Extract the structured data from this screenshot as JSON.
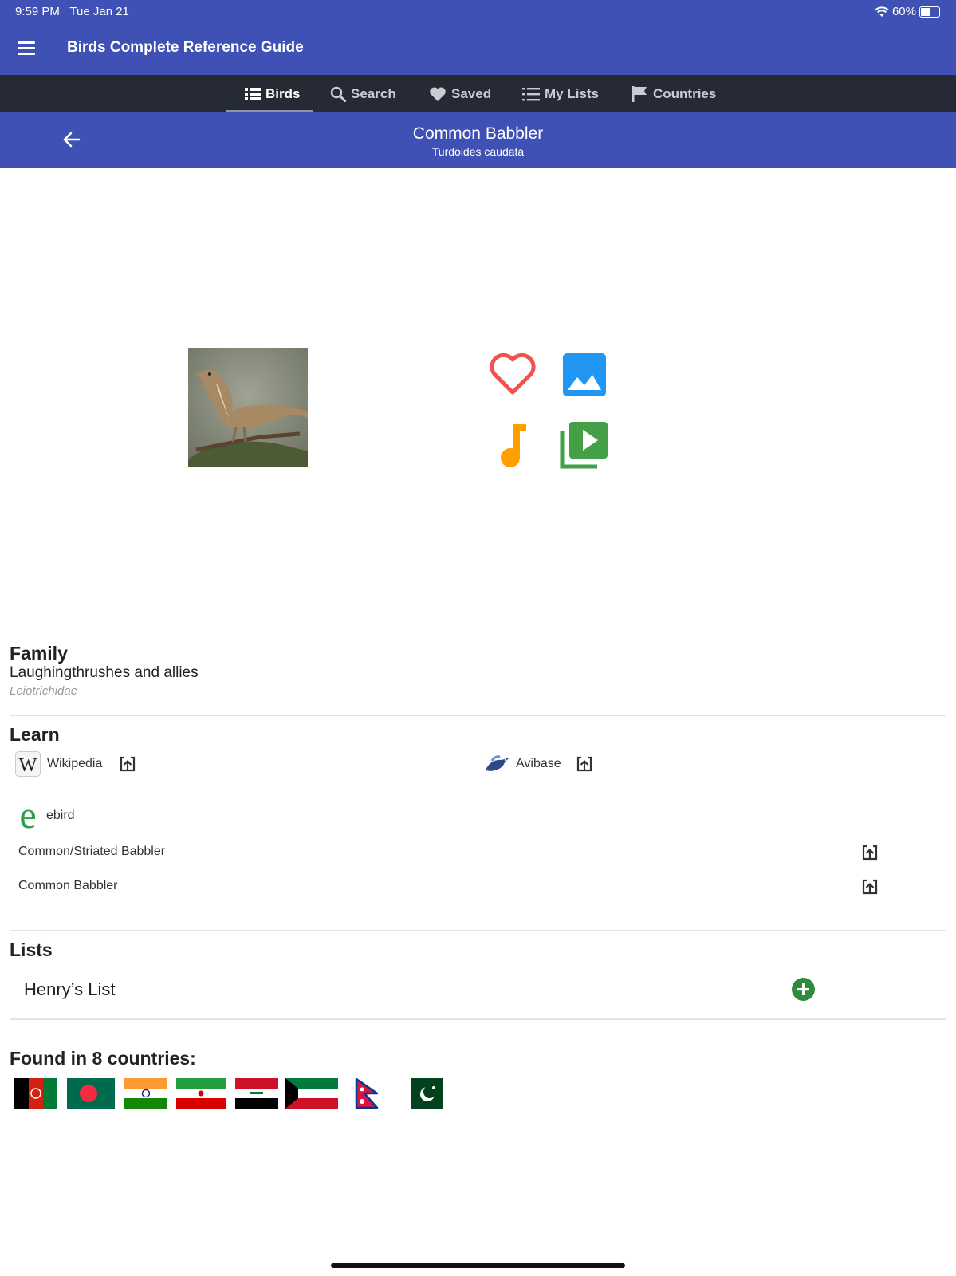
{
  "status_bar": {
    "time": "9:59 PM",
    "date": "Tue Jan 21",
    "battery": "60%",
    "battery_level": 0.6
  },
  "header": {
    "title": "Birds Complete Reference Guide"
  },
  "tabs": [
    {
      "label": "Birds",
      "icon": "list-icon",
      "active": true
    },
    {
      "label": "Search",
      "icon": "search-icon",
      "active": false
    },
    {
      "label": "Saved",
      "icon": "heart-icon",
      "active": false
    },
    {
      "label": "My Lists",
      "icon": "numbered-list-icon",
      "active": false
    },
    {
      "label": "Countries",
      "icon": "flag-icon",
      "active": false
    }
  ],
  "bird": {
    "common_name": "Common Babbler",
    "scientific_name": "Turdoides caudata"
  },
  "actions": [
    {
      "name": "favorite",
      "icon": "heart-outline-icon",
      "color": "#ef5350"
    },
    {
      "name": "photos",
      "icon": "image-icon",
      "color": "#2196f3"
    },
    {
      "name": "audio",
      "icon": "music-note-icon",
      "color": "#ffa000"
    },
    {
      "name": "video",
      "icon": "video-library-icon",
      "color": "#43a047"
    }
  ],
  "family": {
    "heading": "Family",
    "name": "Laughingthrushes and allies",
    "scientific": "Leiotrichidae"
  },
  "learn": {
    "heading": "Learn",
    "wikipedia": "Wikipedia",
    "avibase": "Avibase",
    "ebird": "ebird",
    "ebird_links": [
      "Common/Striated Babbler",
      "Common Babbler"
    ]
  },
  "lists": {
    "heading": "Lists",
    "items": [
      "Henry’s List"
    ]
  },
  "countries": {
    "heading": "Found in 8 countries:",
    "flags": [
      "Afghanistan",
      "Bangladesh",
      "India",
      "Iran",
      "Iraq",
      "Kuwait",
      "Nepal",
      "Pakistan"
    ]
  },
  "colors": {
    "primary": "#3f51b5",
    "tab_bar": "#262a35",
    "add_button": "#2e8b3e"
  }
}
